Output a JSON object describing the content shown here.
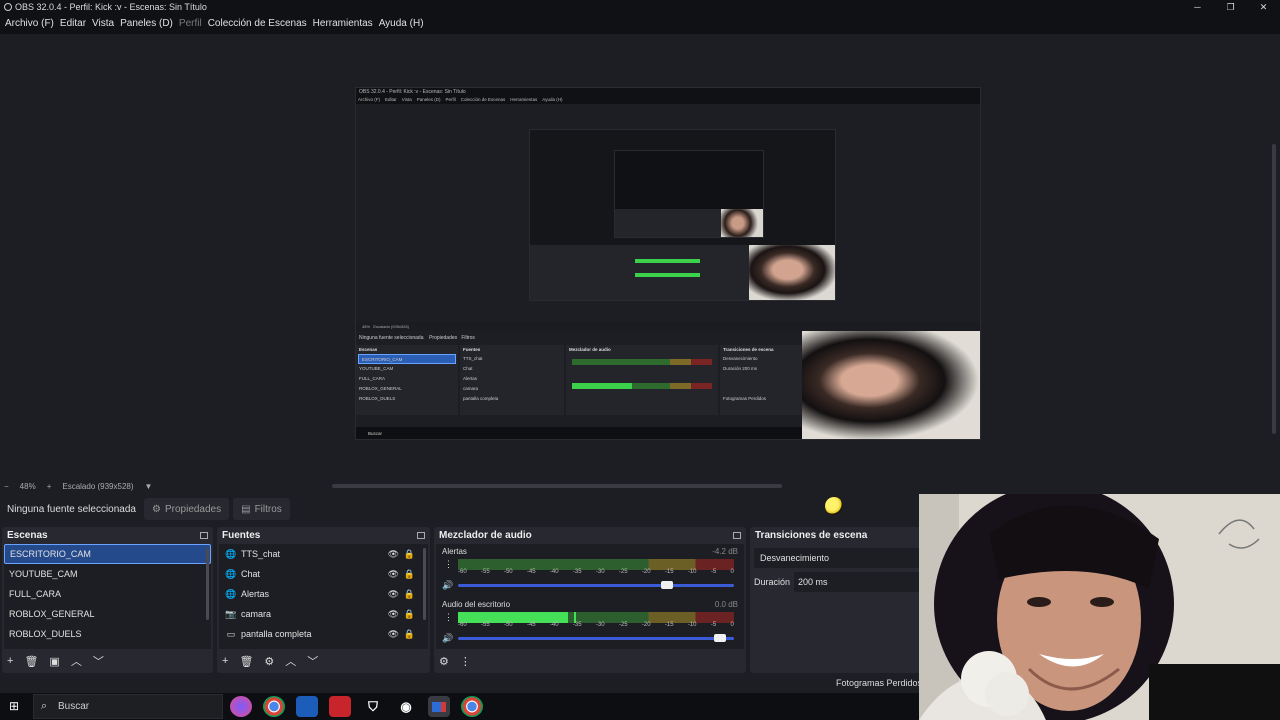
{
  "window": {
    "title": "OBS 32.0.4 - Perfil: Kick :v - Escenas: Sin Título",
    "minimize": "─",
    "restore": "❐",
    "close": "✕"
  },
  "menu": [
    {
      "label": "Archivo (F)",
      "enabled": true
    },
    {
      "label": "Editar",
      "enabled": true
    },
    {
      "label": "Vista",
      "enabled": true
    },
    {
      "label": "Paneles (D)",
      "enabled": true
    },
    {
      "label": "Perfil",
      "enabled": false
    },
    {
      "label": "Colección de Escenas",
      "enabled": true
    },
    {
      "label": "Herramientas",
      "enabled": true
    },
    {
      "label": "Ayuda (H)",
      "enabled": true
    }
  ],
  "nested": {
    "title": "OBS 32.0.4 - Perfil: Kick :v - Escenas: Sin Título",
    "menu": [
      "Archivo (F)",
      "Editar",
      "Vista",
      "Paneles (D)",
      "Perfil",
      "Colección de Escenas",
      "Herramientas",
      "Ayuda (H)"
    ],
    "zoom": "48%",
    "scaled": "Escalado (939x528)",
    "no_source": "Ninguna fuente seleccionada",
    "properties": "Propiedades",
    "filters": "Filtros",
    "scenes_title": "Escenas",
    "sources_title": "Fuentes",
    "mixer_title": "Mezclador de audio",
    "transitions_title": "Transiciones de escena",
    "scenes": [
      "ESCRITORIO_CAM",
      "YOUTUBE_CAM",
      "FULL_CARA",
      "ROBLOX_GENERAL",
      "ROBLOX_DUELS"
    ],
    "sources": [
      "TTS_chat",
      "Chat",
      "Alertas",
      "camara",
      "pantalla completa"
    ],
    "transition": "Desvanecimiento",
    "duration_label": "Duración",
    "duration": "200 ms",
    "dropped": "Fotogramas Perdidos",
    "search": "Buscar"
  },
  "zoombar": {
    "minus": "−",
    "zoom": "48%",
    "plus": "+",
    "scaled": "Escalado (939x528)",
    "dropdown": "▼"
  },
  "properties_bar": {
    "no_source": "Ninguna fuente seleccionada",
    "properties_label": "Propiedades",
    "filters_label": "Filtros"
  },
  "scenes_dock": {
    "title": "Escenas",
    "items": [
      "ESCRITORIO_CAM",
      "YOUTUBE_CAM",
      "FULL_CARA",
      "ROBLOX_GENERAL",
      "ROBLOX_DUELS"
    ],
    "selected_index": 0
  },
  "sources_dock": {
    "title": "Fuentes",
    "items": [
      {
        "name": "TTS_chat",
        "icon": "globe-icon"
      },
      {
        "name": "Chat",
        "icon": "globe-icon"
      },
      {
        "name": "Alertas",
        "icon": "globe-icon"
      },
      {
        "name": "camara",
        "icon": "camera-icon"
      },
      {
        "name": "pantalla completa",
        "icon": "monitor-icon"
      }
    ]
  },
  "mixer_dock": {
    "title": "Mezclador de audio",
    "ticks": [
      "-60",
      "-55",
      "-50",
      "-45",
      "-40",
      "-35",
      "-30",
      "-25",
      "-20",
      "-15",
      "-10",
      "-5",
      "0"
    ],
    "channels": [
      {
        "name": "Alertas",
        "db": "-4.2 dB",
        "level": 0,
        "peak": null,
        "volume": 0.78
      },
      {
        "name": "Audio del escritorio",
        "db": "0.0 dB",
        "level": 0.4,
        "peak": 0.42,
        "volume": 0.97
      }
    ]
  },
  "transitions_dock": {
    "title": "Transiciones de escena",
    "transition": "Desvanecimiento",
    "duration_label": "Duración",
    "duration": "200 ms"
  },
  "status": {
    "dropped_frames": "Fotogramas Perdidos"
  },
  "taskbar": {
    "search_placeholder": "Buscar",
    "apps": [
      "copilot-icon",
      "chrome-icon",
      "bank-app-icon",
      "news-app-icon",
      "shield-app-icon",
      "obs-icon",
      "mail-icon",
      "chrome-alt-icon"
    ],
    "active_app_index": 6
  },
  "colors": {
    "accent": "#2a5fb5",
    "meter_green": "#44e057",
    "volume_blue": "#3c5bd6",
    "background": "#1d1e24",
    "panel": "#272830"
  }
}
